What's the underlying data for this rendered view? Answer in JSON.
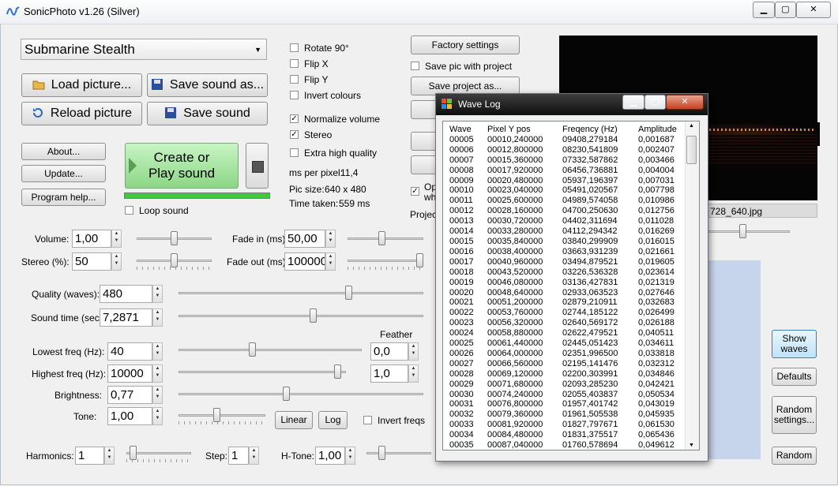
{
  "window": {
    "title": "SonicPhoto v1.26 (Silver)",
    "min": "▁",
    "max": "▢",
    "close": "✕"
  },
  "preset": {
    "selected": "Submarine Stealth"
  },
  "buttons": {
    "load_picture": "Load picture...",
    "save_sound_as": "Save sound as...",
    "reload_picture": "Reload picture",
    "save_sound": "Save sound",
    "about": "About...",
    "update": "Update...",
    "program_help": "Program help...",
    "create_line1": "Create or",
    "create_line2": "Play sound",
    "factory_settings": "Factory settings",
    "save_project_as": "Save project as...",
    "linear": "Linear",
    "log": "Log",
    "show_waves_1": "Show",
    "show_waves_2": "waves",
    "defaults": "Defaults",
    "random_settings_1": "Random",
    "random_settings_2": "settings...",
    "random": "Random"
  },
  "checkboxes": {
    "rotate90": {
      "label": "Rotate 90°",
      "checked": false
    },
    "flipx": {
      "label": "Flip X",
      "checked": false
    },
    "flipy": {
      "label": "Flip Y",
      "checked": false
    },
    "invert_colours": {
      "label": "Invert colours",
      "checked": false
    },
    "normalize_volume": {
      "label": "Normalize volume",
      "checked": true
    },
    "stereo": {
      "label": "Stereo",
      "checked": true
    },
    "extra_high_quality": {
      "label": "Extra high quality",
      "checked": false
    },
    "loop_sound": {
      "label": "Loop sound",
      "checked": false
    },
    "save_pic_with_project": {
      "label": "Save pic with project",
      "checked": false
    },
    "invert_freqs": {
      "label": "Invert freqs",
      "checked": false
    },
    "op_partial": {
      "label_line1": "Op",
      "label_line2": "wh",
      "checked": true
    }
  },
  "info": {
    "ms_per_pixel_label": "ms per pixel:",
    "ms_per_pixel": "11,4",
    "pic_size_label": "Pic size:",
    "pic_size": "640 x 480",
    "time_taken_label": "Time taken:",
    "time_taken": "559 ms",
    "project_partial": "Project",
    "file_partial": "728_640.jpg"
  },
  "controls": {
    "volume": {
      "label": "Volume:",
      "value": "1,00"
    },
    "stereo_pct": {
      "label": "Stereo (%):",
      "value": "50"
    },
    "fade_in": {
      "label": "Fade in (ms):",
      "value": "50,00"
    },
    "fade_out": {
      "label": "Fade out (ms):",
      "value": "100000"
    },
    "quality": {
      "label": "Quality (waves):",
      "value": "480"
    },
    "sound_time": {
      "label": "Sound time (sec)",
      "value": "7,2871"
    },
    "feather_label": "Feather",
    "lowest_freq": {
      "label": "Lowest freq (Hz):",
      "value": "40",
      "feather": "0,0"
    },
    "highest_freq": {
      "label": "Highest freq (Hz):",
      "value": "10000",
      "feather": "1,0"
    },
    "brightness": {
      "label": "Brightness:",
      "value": "0,77"
    },
    "tone": {
      "label": "Tone:",
      "value": "1,00"
    },
    "harmonics": {
      "label": "Harmonics:",
      "value": "1"
    },
    "step": {
      "label": "Step:",
      "value": "1"
    },
    "htone": {
      "label": "H-Tone:",
      "value": "1,00"
    }
  },
  "sliders": {
    "volume": 0.5,
    "stereo": 0.5,
    "fade_in": 0.45,
    "fade_out": 1.0,
    "quality": 0.7,
    "sound_time": 0.55,
    "lowest_freq": 0.4,
    "highest_freq": 0.97,
    "brightness": 0.44,
    "tone": 0.44,
    "harmonics": 0.05,
    "htone": 0.2,
    "preview": 0.5
  },
  "wave_log": {
    "title": "Wave Log",
    "headers": [
      "Wave",
      "Pixel Y pos",
      "Freqency (Hz)",
      "Amplitude"
    ],
    "rows": [
      [
        "00005",
        "00010,240000",
        "09408,279184",
        "0,001687"
      ],
      [
        "00006",
        "00012,800000",
        "08230,541809",
        "0,002407"
      ],
      [
        "00007",
        "00015,360000",
        "07332,587862",
        "0,003466"
      ],
      [
        "00008",
        "00017,920000",
        "06456,736881",
        "0,004004"
      ],
      [
        "00009",
        "00020,480000",
        "05937,196397",
        "0,007031"
      ],
      [
        "00010",
        "00023,040000",
        "05491,020567",
        "0,007798"
      ],
      [
        "00011",
        "00025,600000",
        "04989,574058",
        "0,010986"
      ],
      [
        "00012",
        "00028,160000",
        "04700,250630",
        "0,012756"
      ],
      [
        "00013",
        "00030,720000",
        "04402,311694",
        "0,011028"
      ],
      [
        "00014",
        "00033,280000",
        "04112,294342",
        "0,016269"
      ],
      [
        "00015",
        "00035,840000",
        "03840,299909",
        "0,016015"
      ],
      [
        "00016",
        "00038,400000",
        "03663,931239",
        "0,021661"
      ],
      [
        "00017",
        "00040,960000",
        "03494,879521",
        "0,019605"
      ],
      [
        "00018",
        "00043,520000",
        "03226,536328",
        "0,023614"
      ],
      [
        "00019",
        "00046,080000",
        "03136,427831",
        "0,021319"
      ],
      [
        "00020",
        "00048,640000",
        "02933,063523",
        "0,027646"
      ],
      [
        "00021",
        "00051,200000",
        "02879,210911",
        "0,032683"
      ],
      [
        "00022",
        "00053,760000",
        "02744,185122",
        "0,026499"
      ],
      [
        "00023",
        "00056,320000",
        "02640,569172",
        "0,026188"
      ],
      [
        "00024",
        "00058,880000",
        "02622,479521",
        "0,040511"
      ],
      [
        "00025",
        "00061,440000",
        "02445,051423",
        "0,034611"
      ],
      [
        "00026",
        "00064,000000",
        "02351,996500",
        "0,033818"
      ],
      [
        "00027",
        "00066,560000",
        "02195,141476",
        "0,032312"
      ],
      [
        "00028",
        "00069,120000",
        "02200,303991",
        "0,034846"
      ],
      [
        "00029",
        "00071,680000",
        "02093,285230",
        "0,042421"
      ],
      [
        "00030",
        "00074,240000",
        "02055,403837",
        "0,050534"
      ],
      [
        "00031",
        "00076,800000",
        "01957,401742",
        "0,043019"
      ],
      [
        "00032",
        "00079,360000",
        "01961,505538",
        "0,045935"
      ],
      [
        "00033",
        "00081,920000",
        "01827,797671",
        "0,061530"
      ],
      [
        "00034",
        "00084,480000",
        "01831,375517",
        "0,065436"
      ],
      [
        "00035",
        "00087,040000",
        "01760,578694",
        "0,049612"
      ]
    ]
  }
}
